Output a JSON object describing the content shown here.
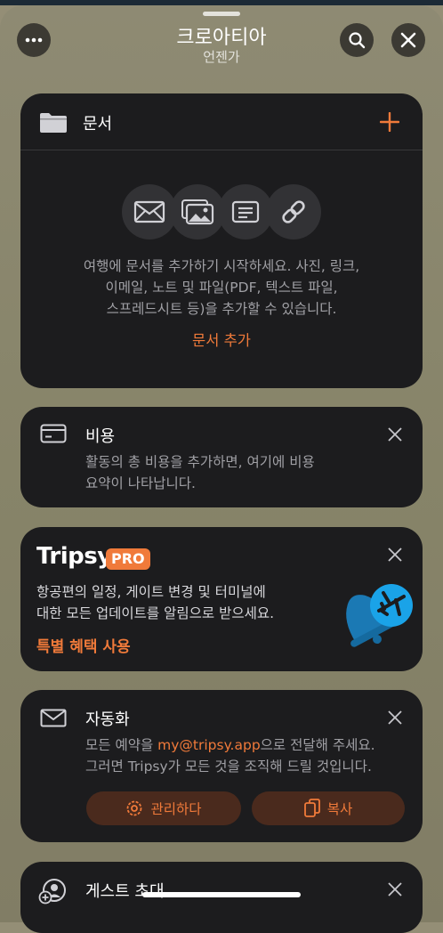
{
  "header": {
    "title": "크로아티아",
    "subtitle": "언젠가"
  },
  "documents": {
    "title": "문서",
    "description_lines": [
      "여행에 문서를 추가하기 시작하세요. 사진, 링크,",
      "이메일, 노트 및 파일(PDF, 텍스트 파일,",
      "스프레드시트 등)을 추가할 수 있습니다."
    ],
    "add_label": "문서 추가"
  },
  "expenses": {
    "title": "비용",
    "description_lines": [
      "활동의 총 비용을 추가하면, 여기에 비용",
      "요약이 나타납니다."
    ]
  },
  "pro_promo": {
    "brand": "Tripsy",
    "badge": "PRO",
    "description_lines": [
      "항공편의 일정, 게이트 변경 및 터미널에",
      "대한 모든 업데이트를 알림으로 받으세요."
    ],
    "cta_label": "특별 혜택 사용"
  },
  "automation": {
    "title": "자동화",
    "line1_prefix": "모든 예약을 ",
    "email": "my@tripsy.app",
    "line1_suffix": "으로 전달해 주세요.",
    "line2": "그러면 Tripsy가 모든 것을 조직해 드릴 것입니다.",
    "manage_label": "관리하다",
    "copy_label": "복사"
  },
  "guests": {
    "title": "게스트 초대"
  },
  "colors": {
    "accent": "#f07a3a",
    "card_bg": "#1c1c1e",
    "sheet_bg": "#8a8670",
    "promo_blue": "#1aa3e8"
  }
}
